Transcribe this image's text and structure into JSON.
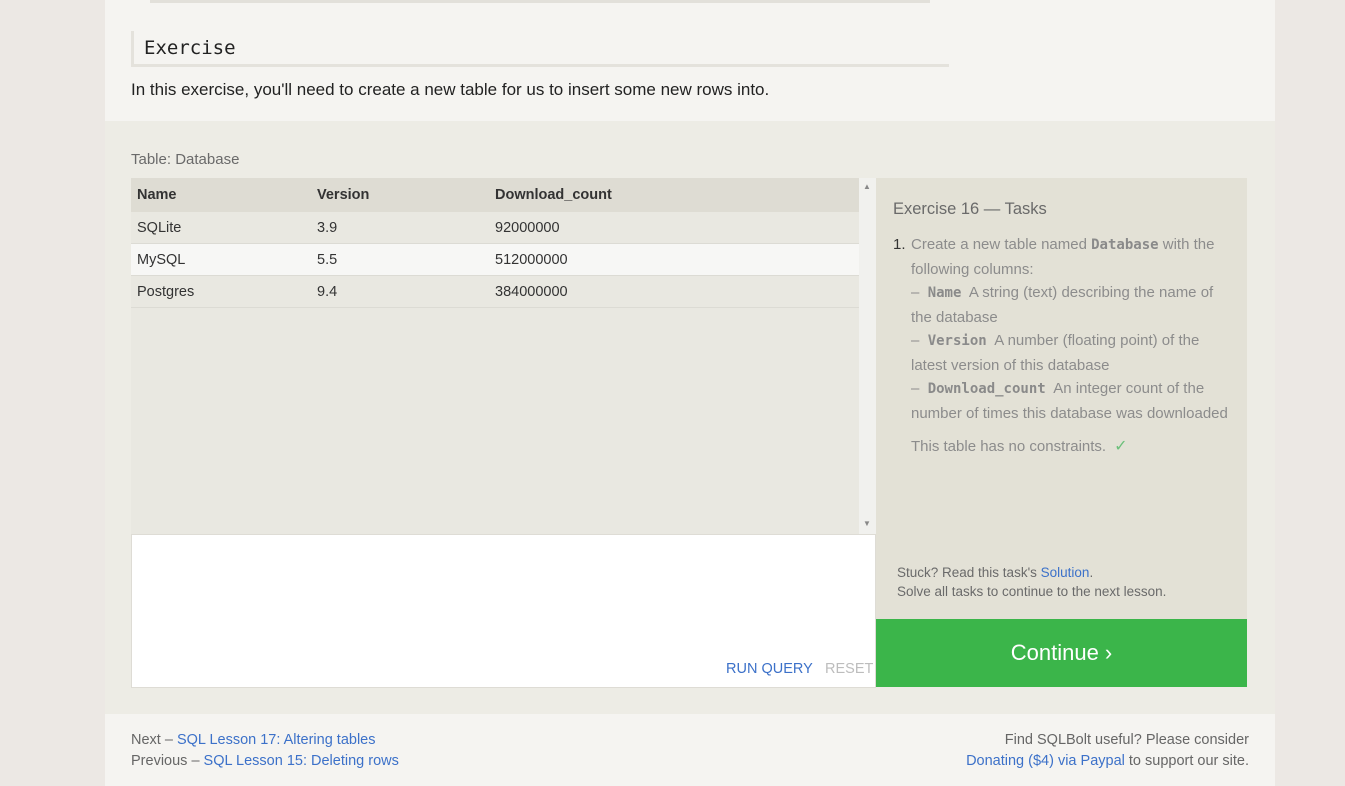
{
  "exercise": {
    "title": "Exercise",
    "intro": "In this exercise, you'll need to create a new table for us to insert some new rows into."
  },
  "table": {
    "caption": "Table: Database",
    "columns": [
      "Name",
      "Version",
      "Download_count"
    ],
    "rows": [
      [
        "SQLite",
        "3.9",
        "92000000"
      ],
      [
        "MySQL",
        "5.5",
        "512000000"
      ],
      [
        "Postgres",
        "9.4",
        "384000000"
      ]
    ]
  },
  "editor": {
    "run_label": "RUN QUERY",
    "reset_label": "RESET"
  },
  "tasks": {
    "title": "Exercise 16 — Tasks",
    "number": "1.",
    "intro_a": "Create a new table named ",
    "intro_code": "Database",
    "intro_b": " with the following columns:",
    "dash": "–",
    "col1_code": "Name",
    "col1_desc": "A string (text) describing the name of the database",
    "col2_code": "Version",
    "col2_desc": "A number (floating point) of the latest version of this database",
    "col3_code": "Download_count",
    "col3_desc": "An integer count of the number of times this database was downloaded",
    "constraint": "This table has no constraints.",
    "check": "✓",
    "stuck_prefix": "Stuck? Read this task's ",
    "solution_link": "Solution",
    "stuck_suffix": ".",
    "solve_all": "Solve all tasks to continue to the next lesson."
  },
  "continue_label": "Continue ›",
  "footer": {
    "next_prefix": "Next – ",
    "next_link": "SQL Lesson 17: Altering tables",
    "prev_prefix": "Previous – ",
    "prev_link": "SQL Lesson 15: Deleting rows",
    "support_line": "Find SQLBolt useful? Please consider",
    "donate_link": "Donating ($4) via Paypal",
    "support_suffix": " to support our site."
  },
  "colors": {
    "accent_link": "#3c71c9",
    "continue_green": "#3bb54a",
    "check_green": "#6cc07b"
  },
  "icons": [
    "scroll-up-icon",
    "scroll-down-icon",
    "check-icon"
  ]
}
